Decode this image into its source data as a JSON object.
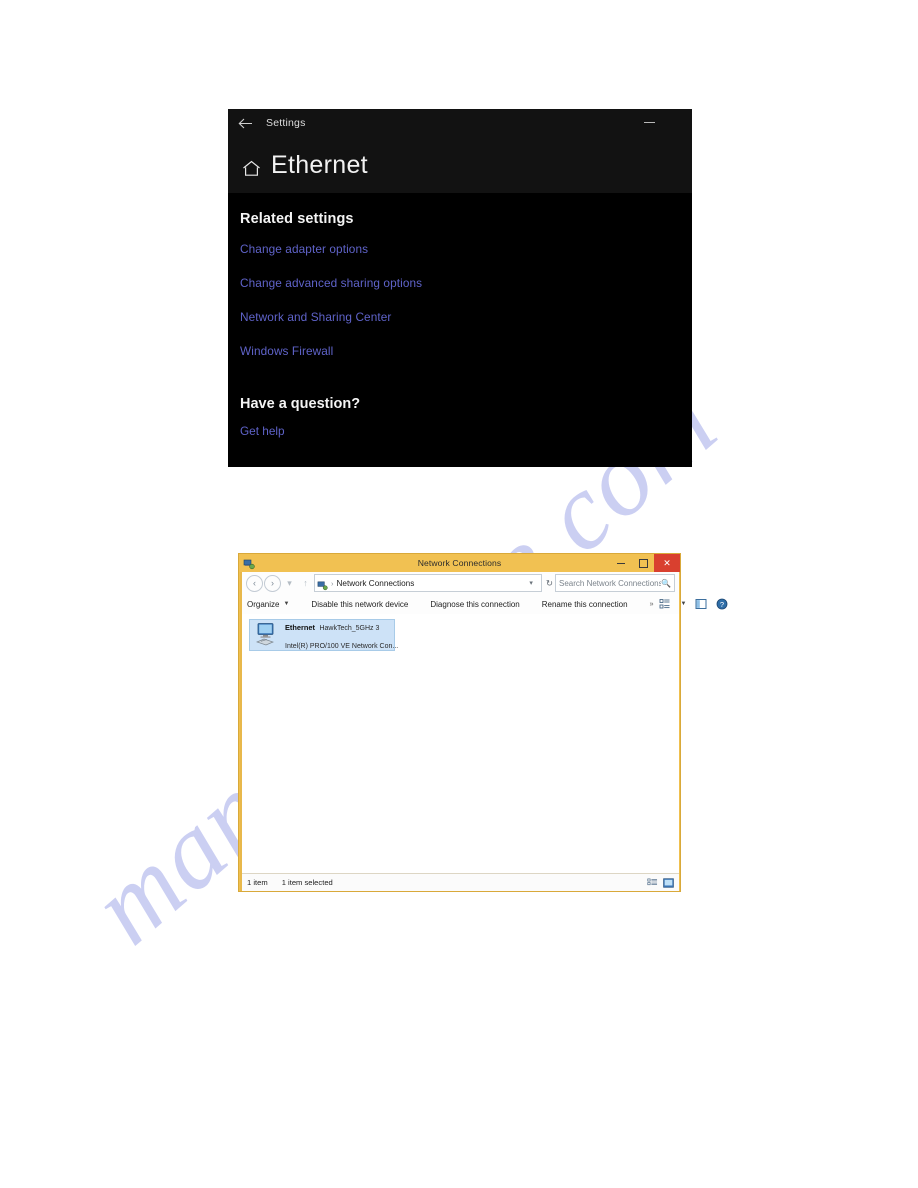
{
  "watermark": {
    "text": "manualshive.com",
    "color": "#c9cdf2"
  },
  "settings_window": {
    "app_title": "Settings",
    "back_icon": "back-arrow-icon",
    "minimize_label": "—",
    "home_icon": "home-icon",
    "page_title": "Ethernet",
    "related_settings": {
      "heading": "Related settings",
      "links": [
        "Change adapter options",
        "Change advanced sharing options",
        "Network and Sharing Center",
        "Windows Firewall"
      ]
    },
    "question": {
      "heading": "Have a question?",
      "link": "Get help"
    },
    "colors": {
      "header_bg": "#121212",
      "body_bg": "#000000",
      "link": "#5f63c9",
      "text": "#f4f4f4"
    }
  },
  "explorer_window": {
    "title": "Network Connections",
    "app_icon": "network-connections-icon",
    "window_buttons": {
      "minimize": "–",
      "maximize": "□",
      "close": "✕"
    },
    "navigation": {
      "back_icon": "chevron-left-circle-icon",
      "forward_icon": "chevron-right-circle-icon",
      "recent_icon": "chevron-down-icon",
      "up_icon": "arrow-up-icon"
    },
    "address_bar": {
      "icon": "network-connections-icon",
      "separator": "›",
      "path": "Network Connections",
      "dropdown_icon": "chevron-down-icon",
      "refresh_icon": "refresh-icon"
    },
    "search": {
      "placeholder": "Search Network Connections",
      "icon": "search-icon"
    },
    "toolbar": {
      "items": [
        {
          "label": "Organize",
          "has_caret": true
        },
        {
          "label": "Disable this network device",
          "has_caret": false
        },
        {
          "label": "Diagnose this connection",
          "has_caret": false
        },
        {
          "label": "Rename this connection",
          "has_caret": false
        }
      ],
      "overflow": "»",
      "right_icons": [
        "change-view-icon",
        "view-dropdown-icon",
        "preview-pane-icon",
        "help-icon"
      ]
    },
    "connections": [
      {
        "name": "Ethernet",
        "network": "HawkTech_5GHz 3",
        "adapter": "Intel(R) PRO/100 VE Network Con...",
        "icon": "network-adapter-icon",
        "selected": true
      }
    ],
    "status_bar": {
      "item_count": "1 item",
      "selection": "1 item selected",
      "icons": [
        "details-view-icon",
        "large-icons-view-icon"
      ]
    },
    "colors": {
      "frame": "#f0c04e",
      "titlebar": "#f1c152",
      "close_button": "#d9402f",
      "selection": "#cde2f7"
    }
  }
}
